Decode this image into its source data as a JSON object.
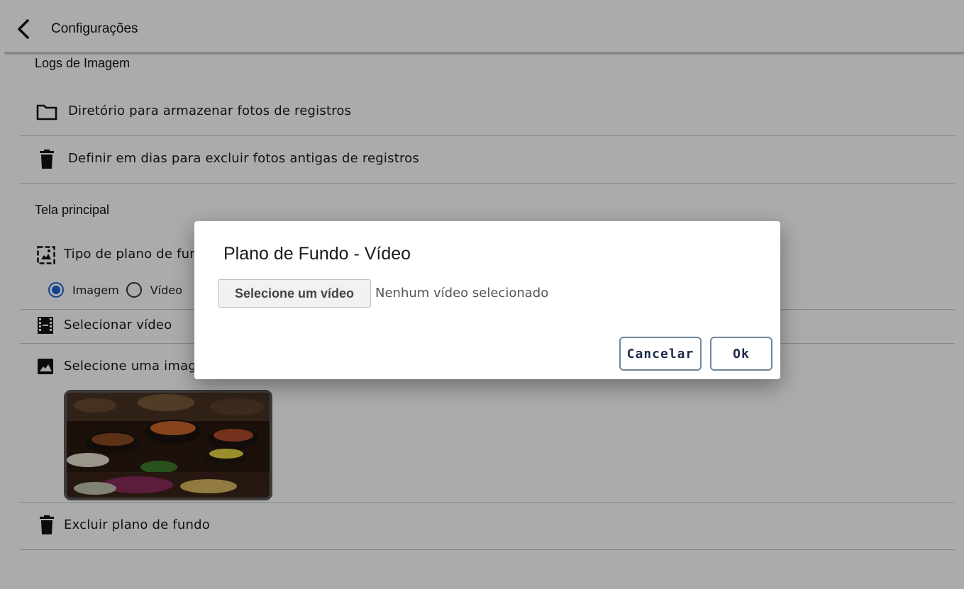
{
  "appbar": {
    "title": "Configurações"
  },
  "sections": {
    "image_logs": {
      "title": "Logs de Imagem",
      "items": [
        {
          "label": "Diretório para armazenar fotos de registros",
          "icon": "folder-icon"
        },
        {
          "label": "Definir em dias para excluir fotos antigas de registros",
          "icon": "trash-icon"
        }
      ]
    },
    "main_screen": {
      "title": "Tela principal",
      "background_type": {
        "label": "Tipo de plano de fundo",
        "icon": "image-frame-icon",
        "options": [
          {
            "label": "Imagem",
            "checked": true
          },
          {
            "label": "Vídeo",
            "checked": false
          }
        ]
      },
      "select_video": {
        "label": "Selecionar vídeo",
        "icon": "film-icon"
      },
      "select_image": {
        "label": "Selecione uma imagem",
        "icon": "photo-icon"
      },
      "delete_background": {
        "label": "Excluir plano de fundo",
        "icon": "trash-icon"
      }
    }
  },
  "dialog": {
    "title": "Plano de Fundo - Vídeo",
    "file_button": "Selecione um vídeo",
    "file_status": "Nenhum vídeo selecionado",
    "cancel": "Cancelar",
    "ok": "Ok"
  },
  "colors": {
    "radio_selected": "#1e63d6",
    "button_border": "#6f879e",
    "button_text": "#1c2b4a"
  }
}
